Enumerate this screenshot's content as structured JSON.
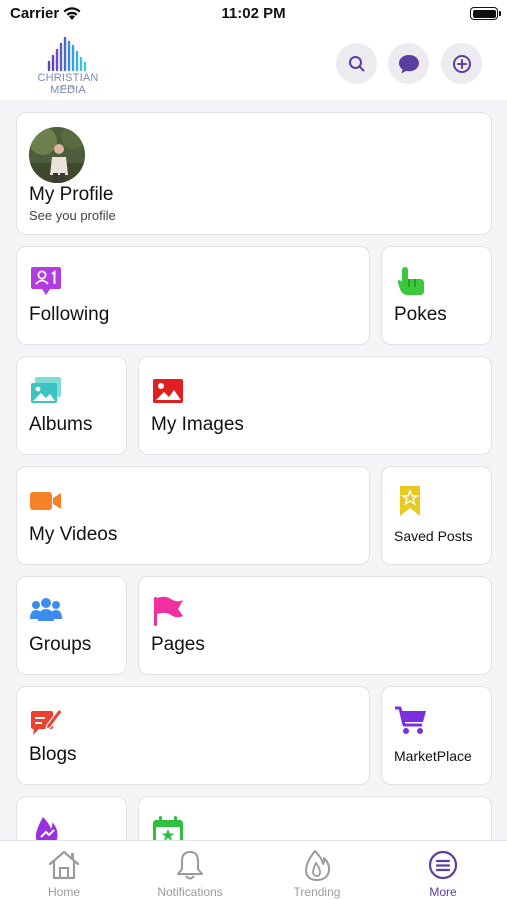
{
  "status_bar": {
    "carrier": "Carrier",
    "time": "11:02 PM"
  },
  "header": {
    "logo_text": "CHRISTIAN MEDIA",
    "logo_sub": "CLUB",
    "buttons": [
      "search-icon",
      "chat-icon",
      "add-circle-icon"
    ]
  },
  "profile": {
    "name": "My Profile",
    "subtitle": "See you profile"
  },
  "menu": {
    "following": "Following",
    "pokes": "Pokes",
    "albums": "Albums",
    "my_images": "My Images",
    "my_videos": "My Videos",
    "saved_posts": "Saved Posts",
    "groups": "Groups",
    "pages": "Pages",
    "blogs": "Blogs",
    "marketplace": "MarketPlace"
  },
  "tabs": [
    {
      "label": "Home",
      "icon": "home-icon",
      "active": false
    },
    {
      "label": "Notifications",
      "icon": "bell-icon",
      "active": false
    },
    {
      "label": "Trending",
      "icon": "flame-icon",
      "active": false
    },
    {
      "label": "More",
      "icon": "menu-icon",
      "active": true
    }
  ],
  "colors": {
    "accent": "#5b3fa0",
    "following": "#b23ce0",
    "pokes": "#3cc83c",
    "albums": "#3cc4c0",
    "my_images": "#e02020",
    "my_videos": "#f7822a",
    "saved_posts": "#e8c91e",
    "groups": "#3c8cf0",
    "pages": "#f02fa0",
    "blogs": "#f04030",
    "marketplace": "#7a2fe0"
  }
}
